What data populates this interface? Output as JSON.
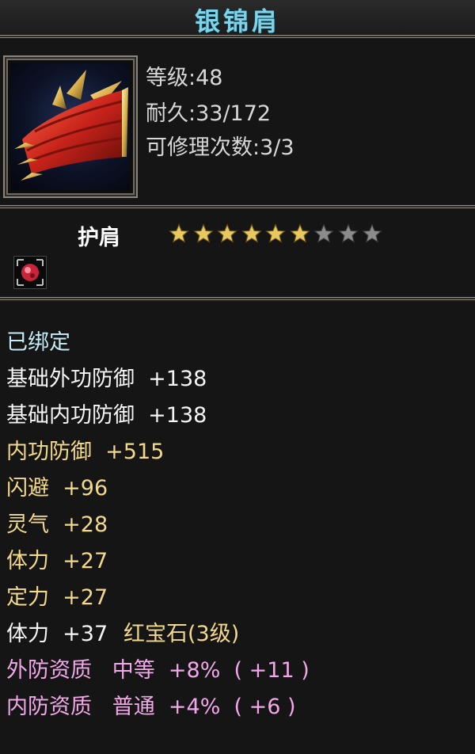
{
  "item": {
    "name": "银锦肩",
    "level_line": "等级:48",
    "durability_line": "耐久:33/172",
    "repair_line": "可修理次数:3/3",
    "type": "护肩",
    "stars_filled": 6,
    "stars_total": 9
  },
  "stats": {
    "bound": "已绑定",
    "base_ext_def": "基础外功防御  +138",
    "base_int_def": "基础内功防御  +138",
    "int_def": "内功防御  +515",
    "dodge": "闪避  +96",
    "spirit": "灵气  +28",
    "stamina": "体力  +27",
    "focus": "定力  +27",
    "gem_stat": "体力  +37",
    "gem_name": "红宝石(3级)",
    "ext_quality": "外防资质   中等  +8%  ( +11 )",
    "int_quality": "内防资质   普通  +4%  ( +6 )"
  },
  "colors": {
    "title": "#7fd3e8",
    "bound": "#c6ecf8",
    "base_stat": "#f5f5f5",
    "attr_stat": "#f3d98a",
    "quality": "#f2a8e8",
    "star_gold": "#e8c860",
    "star_gray": "#8c8c8c"
  }
}
